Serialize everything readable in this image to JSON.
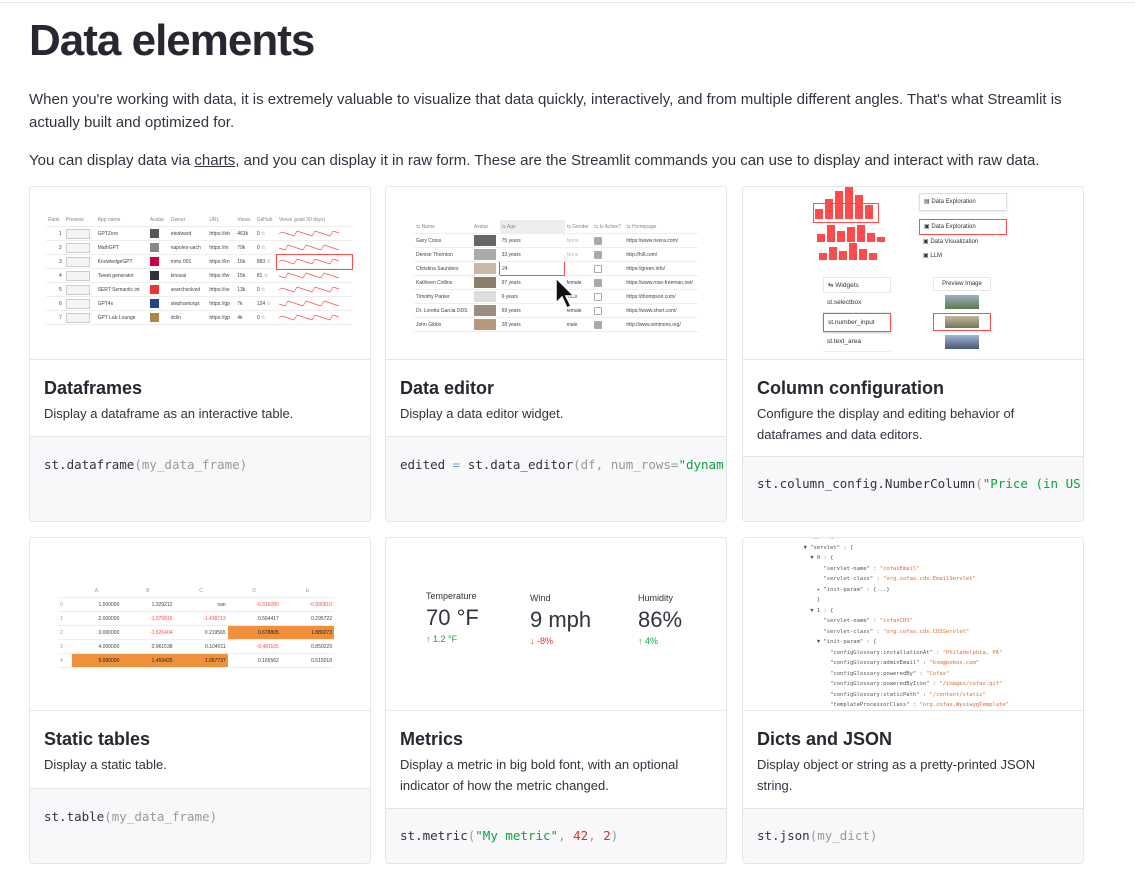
{
  "page": {
    "title": "Data elements",
    "intro": "When you're working with data, it is extremely valuable to visualize that data quickly, interactively, and from multiple different angles. That's what Streamlit is actually built and optimized for.",
    "intro2_before": "You can display data via ",
    "intro2_link": "charts",
    "intro2_after": ", and you can display it in raw form. These are the Streamlit commands you can use to display and interact with raw data."
  },
  "cards": [
    {
      "title": "Dataframes",
      "desc": "Display a dataframe as an interactive table."
    },
    {
      "title": "Data editor",
      "desc": "Display a data editor widget."
    },
    {
      "title": "Column configuration",
      "desc": "Configure the display and editing behavior of dataframes and data editors."
    },
    {
      "title": "Static tables",
      "desc": "Display a static table."
    },
    {
      "title": "Metrics",
      "desc": "Display a metric in big bold font, with an optional indicator of how the metric changed."
    },
    {
      "title": "Dicts and JSON",
      "desc": "Display object or string as a pretty-printed JSON string."
    }
  ],
  "dataframe_thumb": {
    "headers": [
      "Rank",
      "Preview",
      "App name",
      "Avatar",
      "Owner",
      "URL",
      "Views",
      "GitHub",
      "Views (past 30 days)"
    ],
    "rows": [
      [
        "1",
        "GPTZero",
        "etedward",
        "https://eb",
        "463k",
        "0"
      ],
      [
        "2",
        "MathGPT",
        "napoles-uach",
        "https://m",
        "79k",
        "0"
      ],
      [
        "3",
        "KnowledgeGPT",
        "mmz 001",
        "https://kn",
        "16k",
        "883"
      ],
      [
        "4",
        "Tweet generator",
        "kinosal",
        "https://tw",
        "15k",
        "81"
      ],
      [
        "5",
        "SERT Semantic int",
        "searchsolved",
        "https://se",
        "13k",
        "0"
      ],
      [
        "6",
        "GPT4x",
        "stephanturgs",
        "https://gp",
        "7k",
        "124"
      ],
      [
        "7",
        "GPT Lab Lounge",
        "dclin",
        "https://gp",
        "4k",
        "0"
      ]
    ]
  },
  "editor_thumb": {
    "headers": [
      "Name",
      "Avatar",
      "Age",
      "Gender",
      "Is Active?",
      "Homepage"
    ],
    "rows": [
      [
        "Gary Cross",
        "75 years",
        "None",
        "https://www.rivera.com/"
      ],
      [
        "Denise Thornton",
        "33 years",
        "None",
        "http://hill.com/"
      ],
      [
        "Christina Saunders",
        "24",
        "",
        "https://green.info/"
      ],
      [
        "Kathleen Collins",
        "97 years",
        "female",
        "https://www.rose-freeman.net/"
      ],
      [
        "Timothy Parker",
        "6 years",
        "male",
        "https://thompson.com/"
      ],
      [
        "Dr. Loretta Garcia DDS",
        "69 years",
        "female",
        "https://www.short.com/"
      ],
      [
        "John Gibbs",
        "28 years",
        "male",
        "http://www.simmons.org/"
      ]
    ]
  },
  "colconfig_thumb": {
    "menu": [
      "Data Exploration",
      "Data Exploration",
      "Data Visualization",
      "LLM"
    ],
    "widgets_header": "Widgets",
    "widgets": [
      "st.selectbox",
      "st.number_input",
      "st.text_area"
    ],
    "preview_header": "Preview Image"
  },
  "static_thumb": {
    "headers": [
      "",
      "A",
      "B",
      "C",
      "D",
      "E"
    ],
    "rows": [
      [
        "0",
        "1.000000",
        "1.329212",
        "nan",
        "-0.316280",
        "-0.990810"
      ],
      [
        "1",
        "2.000000",
        "-1.070816",
        "-1.438713",
        "0.564417",
        "0.295722"
      ],
      [
        "2",
        "3.000000",
        "-1.626404",
        "0.219565",
        "0.678805",
        "1.889273"
      ],
      [
        "3",
        "4.000000",
        "0.961538",
        "0.104011",
        "-0.481165",
        "0.850229"
      ],
      [
        "4",
        "5.000000",
        "1.453425",
        "1.057737",
        "0.165562",
        "0.515018"
      ]
    ]
  },
  "metrics_thumb": [
    {
      "label": "Temperature",
      "value": "70 °F",
      "delta": "↑ 1.2 °F",
      "dir": "up"
    },
    {
      "label": "Wind",
      "value": "9 mph",
      "delta": "↓ -8%",
      "dir": "down"
    },
    {
      "label": "Humidity",
      "value": "86%",
      "delta": "↑ 4%",
      "dir": "up"
    }
  ],
  "json_thumb": [
    "web-app : {",
    "  ▼ \"servlet\" : [",
    "    ▼ 0 : {",
    "        \"servlet-name\" : \"cofaxEmail\"",
    "        \"servlet-class\" : \"org.cofax.cds.EmailServlet\"",
    "      ▸ \"init-param\" : {...}",
    "      }",
    "    ▼ 1 : {",
    "        \"servlet-name\" : \"cofaxCDS\"",
    "        \"servlet-class\" : \"org.cofax.cds.CDSServlet\"",
    "      ▼ \"init-param\" : {",
    "          \"configGlossary:installationAt\" : \"Philadelphia, PA\"",
    "          \"configGlossary:adminEmail\" : \"ksm@pobox.com\"",
    "          \"configGlossary:poweredBy\" : \"Cofax\"",
    "          \"configGlossary:poweredByIcon\" : \"/images/cofax.gif\"",
    "          \"configGlossary:staticPath\" : \"/content/static\"",
    "          \"templateProcessorClass\" : \"org.cofax.WysiwygTemplate\""
  ],
  "code": {
    "c1": {
      "fn": "st.dataframe",
      "args": "(my_data_frame)"
    },
    "c2": {
      "a": "edited",
      "eq": " = ",
      "fn": "st.data_editor",
      "args": "(df, num_rows=",
      "str": "\"dynam"
    },
    "c3": {
      "fn": "st.column_config.NumberColumn",
      "open": "(",
      "str": "\"Price (in US"
    },
    "c4": {
      "fn": "st.table",
      "args": "(my_data_frame)"
    },
    "c5": {
      "fn": "st.metric",
      "open": "(",
      "str": "\"My metric\"",
      "c1": ", ",
      "n1": "42",
      "c2": ", ",
      "n2": "2",
      "close": ")"
    },
    "c6": {
      "fn": "st.json",
      "args": "(my_dict)"
    }
  },
  "colors": {
    "accent": "#ff4b4b",
    "string": "#09a33a",
    "number": "#d03030",
    "highlight": "#f0903a"
  }
}
